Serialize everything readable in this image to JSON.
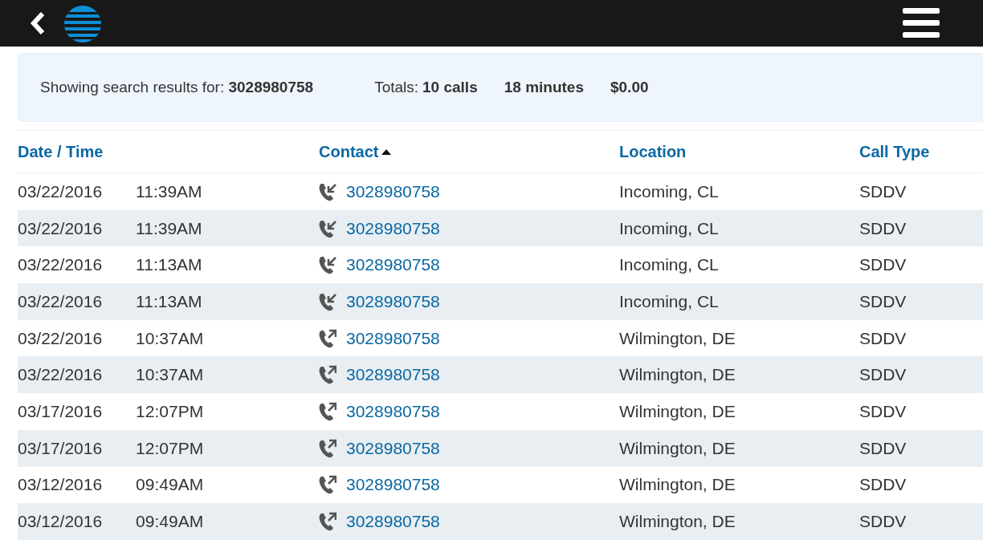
{
  "summary": {
    "label": "Showing search results for:",
    "query": "3028980758",
    "totals_label": "Totals:",
    "calls": "10 calls",
    "minutes": "18 minutes",
    "cost": "$0.00"
  },
  "table": {
    "columns": [
      {
        "label": "Date / Time",
        "sorted": false
      },
      {
        "label": "Contact",
        "sorted": true
      },
      {
        "label": "Location",
        "sorted": false
      },
      {
        "label": "Call Type",
        "sorted": false
      }
    ],
    "rows": [
      {
        "date": "03/22/2016",
        "time": "11:39AM",
        "kind": "incoming",
        "contact": "3028980758",
        "location": "Incoming, CL",
        "call_type": "SDDV"
      },
      {
        "date": "03/22/2016",
        "time": "11:39AM",
        "kind": "incoming",
        "contact": "3028980758",
        "location": "Incoming, CL",
        "call_type": "SDDV"
      },
      {
        "date": "03/22/2016",
        "time": "11:13AM",
        "kind": "incoming",
        "contact": "3028980758",
        "location": "Incoming, CL",
        "call_type": "SDDV"
      },
      {
        "date": "03/22/2016",
        "time": "11:13AM",
        "kind": "incoming",
        "contact": "3028980758",
        "location": "Incoming, CL",
        "call_type": "SDDV"
      },
      {
        "date": "03/22/2016",
        "time": "10:37AM",
        "kind": "outgoing",
        "contact": "3028980758",
        "location": "Wilmington, DE",
        "call_type": "SDDV"
      },
      {
        "date": "03/22/2016",
        "time": "10:37AM",
        "kind": "outgoing",
        "contact": "3028980758",
        "location": "Wilmington, DE",
        "call_type": "SDDV"
      },
      {
        "date": "03/17/2016",
        "time": "12:07PM",
        "kind": "outgoing",
        "contact": "3028980758",
        "location": "Wilmington, DE",
        "call_type": "SDDV"
      },
      {
        "date": "03/17/2016",
        "time": "12:07PM",
        "kind": "outgoing",
        "contact": "3028980758",
        "location": "Wilmington, DE",
        "call_type": "SDDV"
      },
      {
        "date": "03/12/2016",
        "time": "09:49AM",
        "kind": "outgoing",
        "contact": "3028980758",
        "location": "Wilmington, DE",
        "call_type": "SDDV"
      },
      {
        "date": "03/12/2016",
        "time": "09:49AM",
        "kind": "outgoing",
        "contact": "3028980758",
        "location": "Wilmington, DE",
        "call_type": "SDDV"
      }
    ]
  }
}
